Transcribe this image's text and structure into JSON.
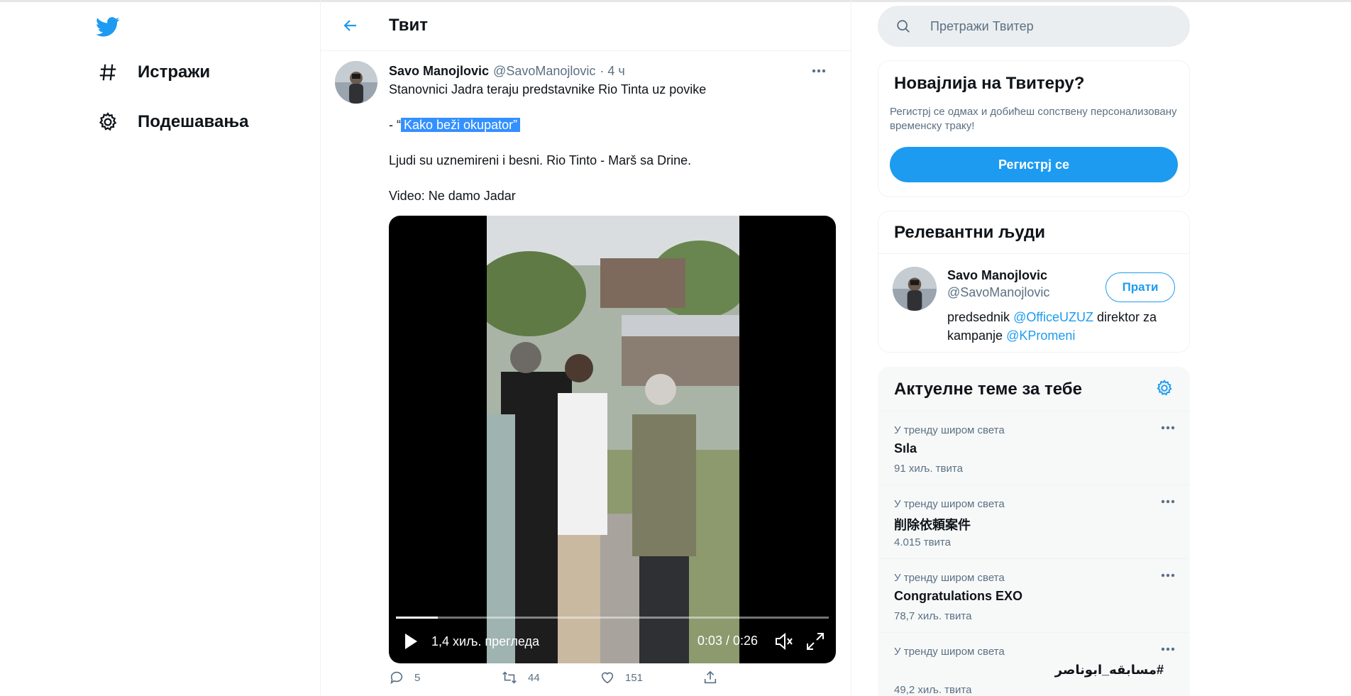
{
  "nav": {
    "explore_label": "Истражи",
    "settings_label": "Подешавања"
  },
  "header": {
    "title": "Твит"
  },
  "tweet": {
    "author_name": "Savo Manojlovic",
    "author_handle": "@SavoManojlovic",
    "time_ago": "· 4 ч",
    "line1": "Stanovnici Jadra teraju predstavnike Rio Tinta uz povike",
    "line2_prefix": "- “",
    "line2_highlight": "Kako beži okupator”",
    "line3": "Ljudi su uznemireni i besni. Rio Tinto - Marš sa Drine.",
    "line4": "Video: Ne damo Jadar",
    "video": {
      "views": "1,4 хиљ. прегледа",
      "time": "0:03 / 0:26",
      "progress": 0.097
    },
    "actions": {
      "replies": "5",
      "retweets": "44",
      "likes": "151"
    }
  },
  "search": {
    "placeholder": "Претражи Твитер"
  },
  "new_card": {
    "title": "Новајлија на Твитеру?",
    "description": "Регистрј се одмах и добићеш сопствену персонализовану временску траку!",
    "signup_label": "Регистрј се"
  },
  "relevant": {
    "title": "Релевантни људи",
    "name": "Savo Manojlovic",
    "handle": "@SavoManojlovic",
    "bio_1": "predsednik ",
    "bio_link1": "@OfficeUZUZ",
    "bio_2": " direktor za kampanje ",
    "bio_link2": "@KPromeni",
    "follow_label": "Прати"
  },
  "trends": {
    "title": "Актуелне теме за тебе",
    "items": [
      {
        "context": "У тренду широм света",
        "topic": "Sıla",
        "count": "91 хиљ. твита"
      },
      {
        "context": "У тренду широм света",
        "topic": "削除依頼案件",
        "count": "4.015 твита"
      },
      {
        "context": "У тренду широм света",
        "topic": "Congratulations EXO",
        "count": "78,7 хиљ. твита"
      },
      {
        "context": "У тренду широм света",
        "topic": "#مسابقه_ابوناصر",
        "count": "49,2 хиљ. твита"
      }
    ]
  },
  "colors": {
    "accent": "#1d9bf0",
    "text": "#0f1419",
    "secondary": "#5b7083",
    "highlight": "#3390ff"
  }
}
